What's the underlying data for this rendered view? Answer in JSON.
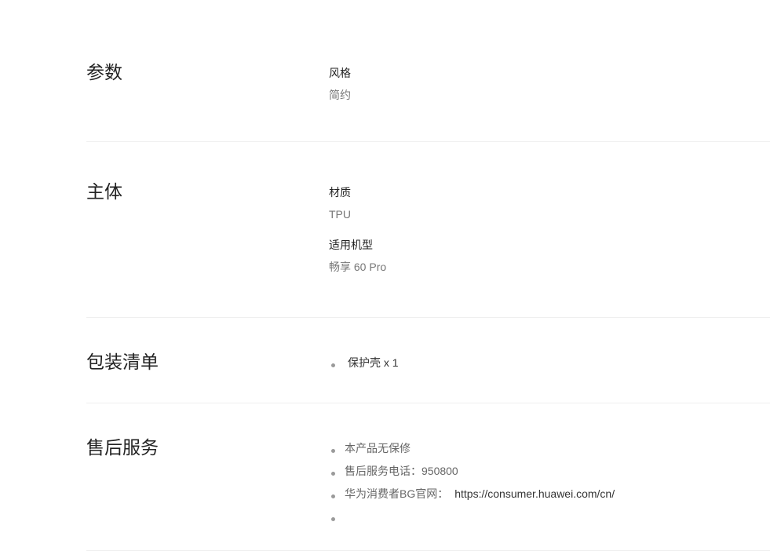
{
  "sections": {
    "params": {
      "title": "参数",
      "items": [
        {
          "name": "风格",
          "value": "简约"
        }
      ]
    },
    "body": {
      "title": "主体",
      "items": [
        {
          "name": "材质",
          "value": "TPU"
        },
        {
          "name": "适用机型",
          "value": "畅享 60 Pro"
        }
      ]
    },
    "package": {
      "title": "包装清单",
      "items": [
        "保护壳 x 1"
      ]
    },
    "service": {
      "title": "售后服务",
      "items": [
        {
          "text": "本产品无保修"
        },
        {
          "text": "售后服务电话：950800"
        },
        {
          "text": "华为消费者BG官网：",
          "link": "https://consumer.huawei.com/cn/"
        },
        {
          "text": ""
        }
      ]
    }
  }
}
